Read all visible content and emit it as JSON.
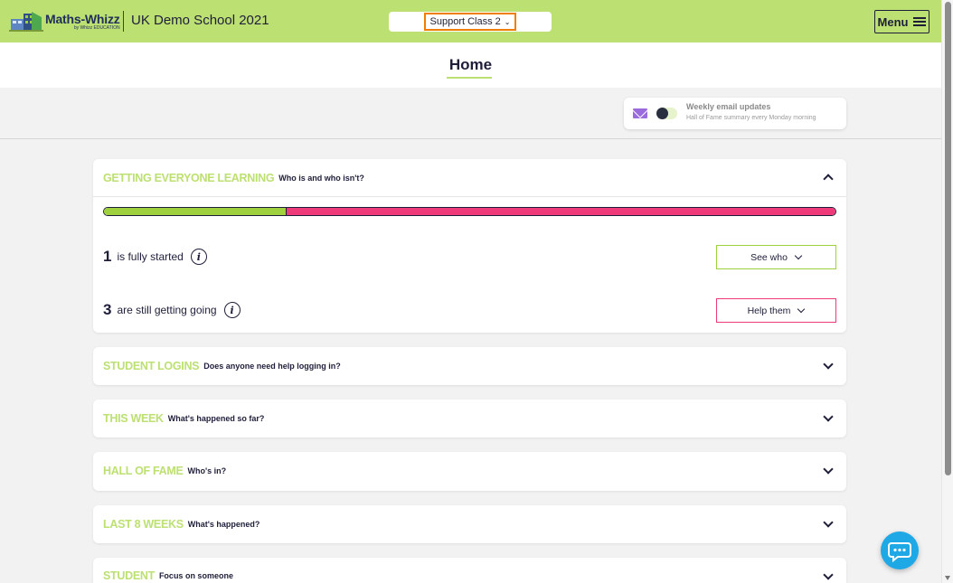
{
  "header": {
    "logo_text": "Maths-Whizz",
    "logo_subtext": "by Whizz EDUCATION",
    "school_name": "UK Demo School 2021",
    "class_selected": "Support Class 2",
    "menu_label": "Menu"
  },
  "page": {
    "title": "Home"
  },
  "email_updates": {
    "title": "Weekly email updates",
    "subtitle": "Hall of Fame summary every Monday morning",
    "enabled": false
  },
  "sections": [
    {
      "title": "GETTING EVERYONE LEARNING",
      "subtitle": "Who is and who isn't?",
      "expanded": true,
      "progress": {
        "started": 1,
        "getting_going": 3
      },
      "rows": [
        {
          "count": "1",
          "label": "is fully started",
          "action": "See who"
        },
        {
          "count": "3",
          "label": "are still getting going",
          "action": "Help them"
        }
      ]
    },
    {
      "title": "STUDENT LOGINS",
      "subtitle": "Does anyone need help logging in?",
      "expanded": false
    },
    {
      "title": "THIS WEEK",
      "subtitle": "What's happened so far?",
      "expanded": false
    },
    {
      "title": "HALL OF FAME",
      "subtitle": "Who's in?",
      "expanded": false
    },
    {
      "title": "LAST 8 WEEKS",
      "subtitle": "What's happened?",
      "expanded": false
    },
    {
      "title": "STUDENT",
      "subtitle": "Focus on someone",
      "expanded": false
    }
  ],
  "colors": {
    "brand_green": "#bde072",
    "started_green": "#9ed13d",
    "going_pink": "#ee3a78",
    "highlight_orange": "#f07d00",
    "chat_blue": "#1fa8e6"
  },
  "icons": [
    "logo-icon",
    "chevron-down-icon",
    "hamburger-icon",
    "mail-icon",
    "info-icon",
    "chevron-up-icon",
    "chat-icon"
  ]
}
